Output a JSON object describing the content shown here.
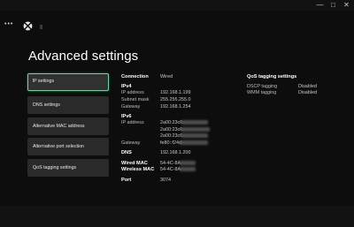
{
  "window": {
    "minimize_glyph": "—",
    "maximize_glyph": "□",
    "close_glyph": "✕"
  },
  "header": {
    "menu_glyph": "•••",
    "logo_icon": "xbox-logo-icon"
  },
  "page_title": "Advanced settings",
  "nav": [
    {
      "label": "IP settings",
      "active": true
    },
    {
      "label": "DNS settings",
      "active": false
    },
    {
      "label": "Alternative MAC address",
      "active": false
    },
    {
      "label": "Alternative port selection",
      "active": false
    },
    {
      "label": "QoS tagging settings",
      "active": false
    }
  ],
  "info": {
    "connection_label": "Connection",
    "connection_value": "Wired",
    "ipv4_header": "IPv4",
    "ipv4": {
      "ip_label": "IP address",
      "ip_value": "192.168.1.199",
      "subnet_label": "Subnet mask",
      "subnet_value": "255.255.255.0",
      "gateway_label": "Gateway",
      "gateway_value": "192.168.1.254"
    },
    "ipv6_header": "IPv6",
    "ipv6": {
      "ip_label": "IP address",
      "ip_values": [
        "2a00:23c6:",
        "2a00:23c6:",
        "2a00:23c6:"
      ],
      "gateway_label": "Gateway",
      "gateway_value": "fe80::f24d:"
    },
    "dns_label": "DNS",
    "dns_value": "192.168.1.200",
    "wired_mac_label": "Wired MAC",
    "wired_mac_value": "54-4C-8A-",
    "wireless_mac_label": "Wireless MAC",
    "wireless_mac_value": "54-4C-8A-",
    "port_label": "Port",
    "port_value": "3074"
  },
  "qos": {
    "header": "QoS tagging settings",
    "dscp_label": "DSCP tagging",
    "dscp_value": "Disabled",
    "wmm_label": "WMM tagging",
    "wmm_value": "Disabled"
  }
}
